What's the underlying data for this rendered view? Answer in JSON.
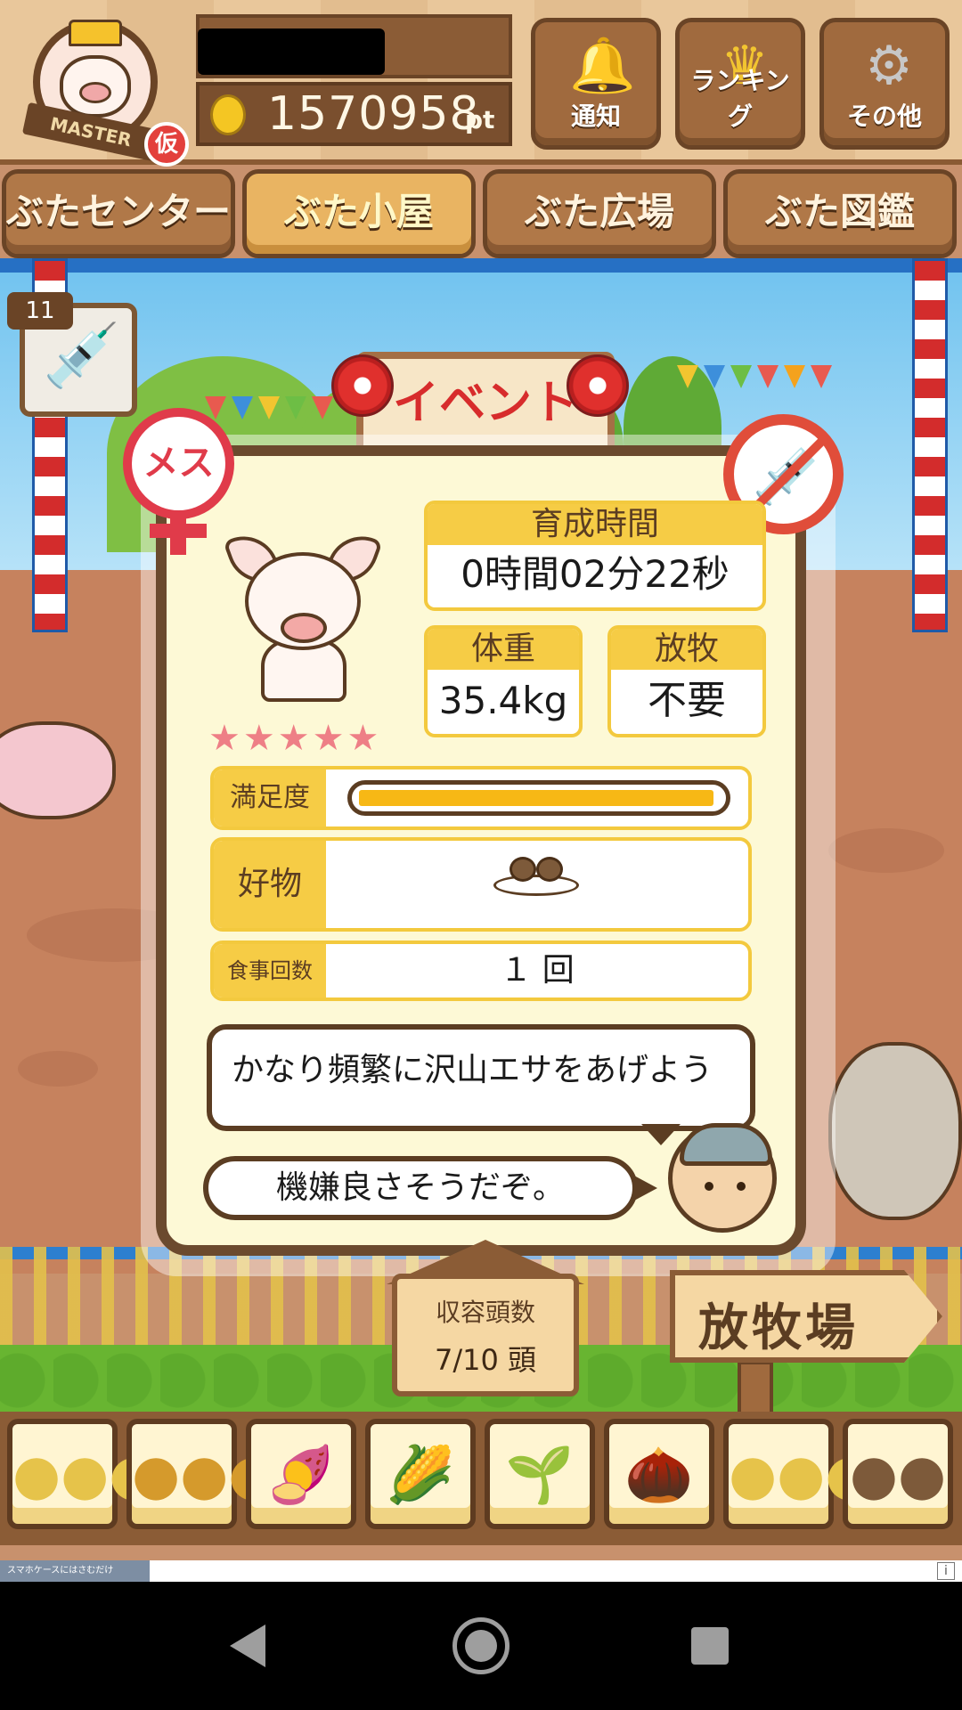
{
  "header": {
    "points": "1570958",
    "points_unit": "pt",
    "avatar_banner": "MASTER",
    "avatar_tag": "仮",
    "buttons": [
      {
        "label": "通知",
        "icon": "bell-icon"
      },
      {
        "label": "ランキング",
        "icon": "crown-icon"
      },
      {
        "label": "その他",
        "icon": "gear-icon"
      }
    ]
  },
  "tabs": [
    {
      "label": "ぶたセンター",
      "active": false
    },
    {
      "label": "ぶた小屋",
      "active": true
    },
    {
      "label": "ぶた広場",
      "active": false
    },
    {
      "label": "ぶた図鑑",
      "active": false
    }
  ],
  "side_item": {
    "count": "11",
    "icon": "syringe-icon"
  },
  "scene": {
    "event_sign": "イベント"
  },
  "pig": {
    "gender_label": "メス",
    "injection_status_icon": "no-syringe-icon",
    "stars": "★★★★★",
    "growth_time_label": "育成時間",
    "growth_time_value": "0時間02分22秒",
    "weight_label": "体重",
    "weight_value": "35.4kg",
    "grazing_label": "放牧",
    "grazing_value": "不要",
    "satisfaction_label": "満足度",
    "satisfaction_level": 0.97,
    "favorite_label": "好物",
    "favorite_icon": "dumpling-plate-icon",
    "meals_label": "食事回数",
    "meals_value": "１ 回",
    "advice": "かなり頻繁に沢山エサをあげよう",
    "mood": "機嫌良さそうだぞ。"
  },
  "capacity": {
    "label": "収容頭数",
    "value": "7/10 頭"
  },
  "pasture_sign": "放牧場",
  "food_bar": [
    {
      "icon": "grain-pile-icon"
    },
    {
      "icon": "mixed-grain-icon"
    },
    {
      "icon": "sweet-potato-icon"
    },
    {
      "icon": "corn-icon"
    },
    {
      "icon": "soybean-icon"
    },
    {
      "icon": "acorn-icon"
    },
    {
      "icon": "grain-plate-icon"
    },
    {
      "icon": "dumpling-plate-icon"
    }
  ],
  "ad": {
    "text": "スマホケースにはさむだけ",
    "info": "i"
  }
}
